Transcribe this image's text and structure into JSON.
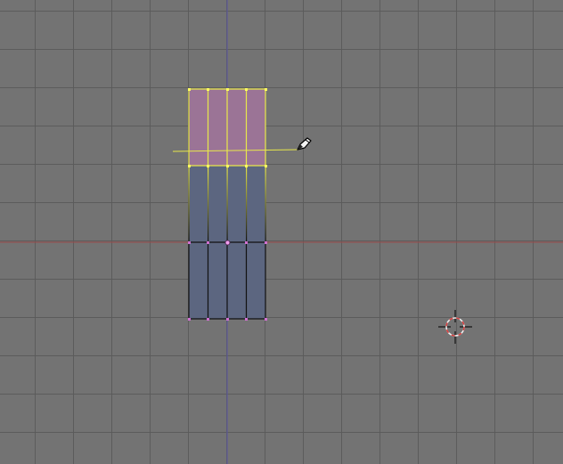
{
  "viewport": {
    "name": "3D View",
    "mode": "edit-mesh"
  },
  "colors": {
    "background": "#737373",
    "grid": "#5a5a5a",
    "x_axis": "#9a4a4a",
    "y_axis": "#5a55a0",
    "face": "#5c6680",
    "face_selected": "#9b7496",
    "edge": "#000000",
    "edge_selected": "#e8e84a",
    "vertex_selected": "#ffff60",
    "vertex": "#d070d0",
    "cursor_ring_red": "#d84040",
    "cursor_ring_white": "#f0f0f0"
  },
  "icons": {
    "mouse_cursor": "pen-cursor-icon",
    "scene_cursor": "3d-cursor-icon"
  },
  "mesh": {
    "columns": 4,
    "rows": 3,
    "selected_rows": [
      0
    ]
  }
}
